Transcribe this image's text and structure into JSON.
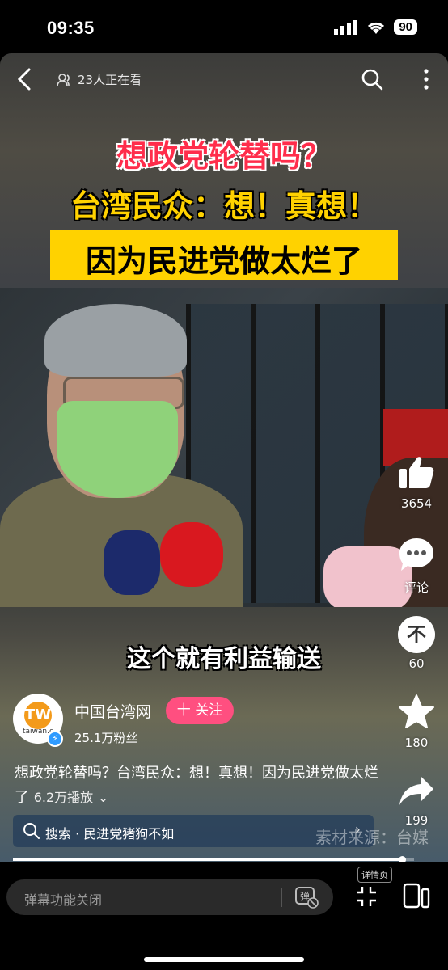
{
  "status_bar": {
    "time": "09:35",
    "battery": "90"
  },
  "top_bar": {
    "viewers": "23人正在看"
  },
  "video": {
    "title_line1": "想政党轮替吗？",
    "title_line2": "台湾民众：想！真想！",
    "title_line3": "因为民进党做太烂了",
    "subtitle": "这个就有利益输送",
    "source_watermark": "素材来源：台媒",
    "progress": 0.97
  },
  "rail": {
    "likes": "3654",
    "comment_label": "评论",
    "coins": "60",
    "coin_glyph": "不",
    "favorites": "180",
    "shares": "199"
  },
  "author": {
    "name": "中国台湾网",
    "follow_label": "十 关注",
    "fans": "25.1万粉丝",
    "avatar_text": "taiwan.c"
  },
  "description": {
    "text": "想政党轮替吗？台湾民众：想！真想！因为民进党做太烂了",
    "plays": "6.2万播放"
  },
  "search_chip": {
    "label": "搜索 · 民进党猪狗不如"
  },
  "bottom": {
    "danmu_placeholder": "弹幕功能关闭",
    "danmu_icon_glyph": "弹",
    "detail_label": "详情页"
  },
  "colors": {
    "follow": "#ff4f80",
    "title_red": "#ff2d4b",
    "title_yellow": "#ffd200"
  }
}
